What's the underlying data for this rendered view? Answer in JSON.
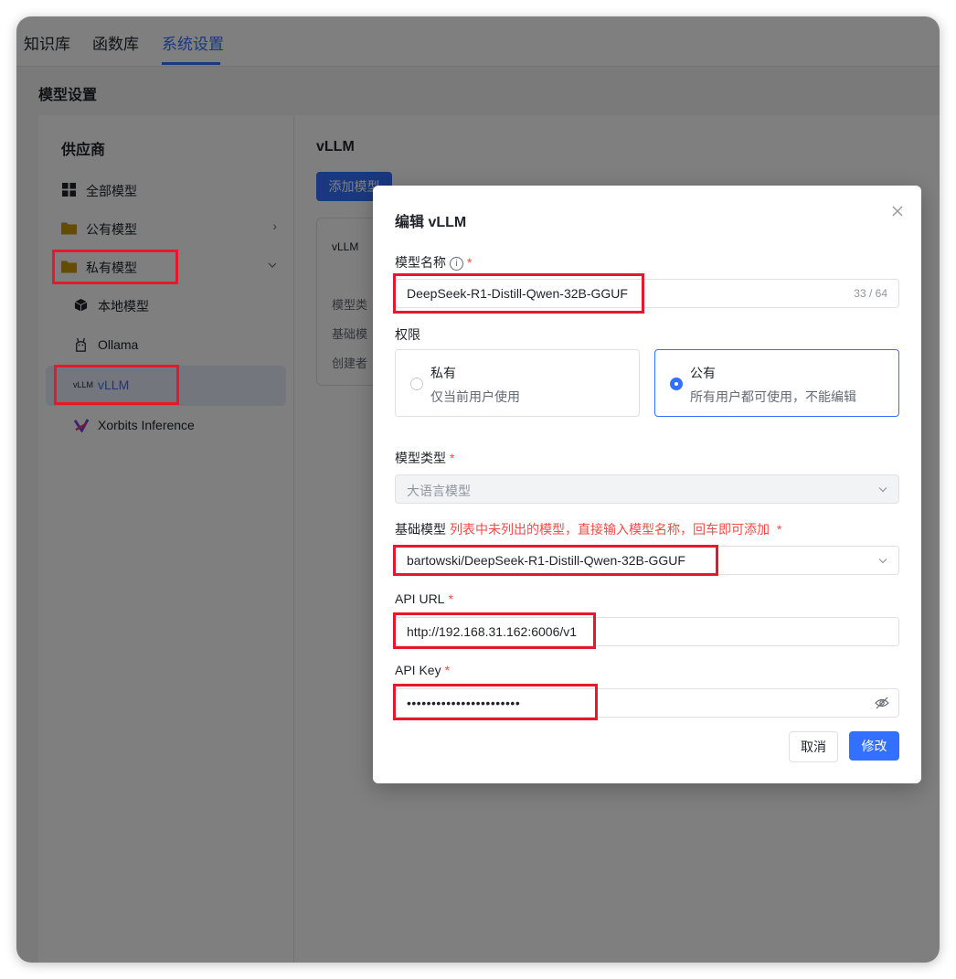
{
  "nav": {
    "tabs": [
      "知识库",
      "函数库",
      "系统设置"
    ],
    "active": 2
  },
  "page": {
    "title": "模型设置"
  },
  "sidebar": {
    "title": "供应商",
    "items": [
      {
        "label": "全部模型",
        "icon": "grid-icon"
      },
      {
        "label": "公有模型",
        "icon": "folder-icon"
      },
      {
        "label": "私有模型",
        "icon": "folder-icon"
      },
      {
        "label": "本地模型",
        "icon": "cube-icon"
      },
      {
        "label": "Ollama",
        "icon": "llama-icon"
      },
      {
        "label": "vLLM",
        "icon": "vllm-logo-icon",
        "logo_text": "vLLM"
      },
      {
        "label": "Xorbits Inference",
        "icon": "xorbits-logo-icon"
      }
    ],
    "selected": "vLLM"
  },
  "content": {
    "title": "vLLM",
    "add_button": "添加模型",
    "card": {
      "logo": "vLLM",
      "rows": [
        "模型类",
        "基础模",
        "创建者"
      ]
    }
  },
  "dialog": {
    "title": "编辑 vLLM",
    "name_label": "模型名称",
    "name_value": "DeepSeek-R1-Distill-Qwen-32B-GGUF",
    "name_counter": "33 / 64",
    "permission_label": "权限",
    "permissions": [
      {
        "title": "私有",
        "desc": "仅当前用户使用",
        "checked": false
      },
      {
        "title": "公有",
        "desc": "所有用户都可使用，不能编辑",
        "checked": true
      }
    ],
    "type_label": "模型类型",
    "type_value": "大语言模型",
    "base_label": "基础模型",
    "base_hint": "列表中未列出的模型，直接输入模型名称，回车即可添加",
    "base_value": "bartowski/DeepSeek-R1-Distill-Qwen-32B-GGUF",
    "url_label": "API URL",
    "url_value": "http://192.168.31.162:6006/v1",
    "key_label": "API Key",
    "key_value": "•••••••••••••••••••••••",
    "required_mark": "*",
    "cancel": "取消",
    "confirm": "修改"
  },
  "colors": {
    "accent": "#3370ff",
    "required": "#f54a45",
    "highlight": "#e8182c",
    "folder": "#c99a06"
  }
}
